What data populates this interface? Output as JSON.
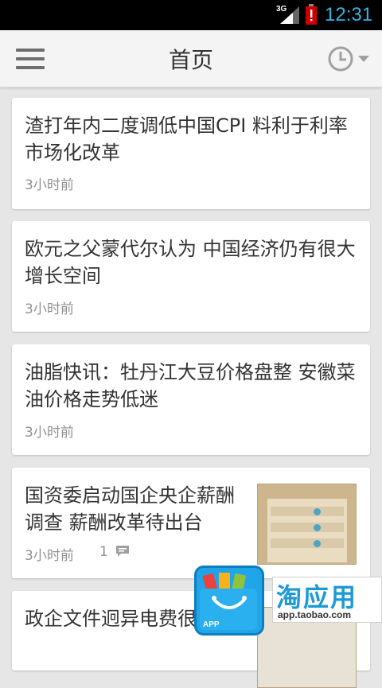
{
  "status_bar": {
    "network_type": "3G",
    "time": "12:31",
    "accent_color": "#33b5e5",
    "battery_color": "#cc0000"
  },
  "app_bar": {
    "title": "首页",
    "menu_icon": "hamburger-icon",
    "history_icon": "clock-icon"
  },
  "articles": [
    {
      "title": "渣打年内二度调低中国CPI 料利于利率市场化改革",
      "time": "3小时前",
      "comments": ""
    },
    {
      "title": "欧元之父蒙代尔认为 中国经济仍有很大增长空间",
      "time": "3小时前",
      "comments": ""
    },
    {
      "title": "油脂快讯：牡丹江大豆价格盘整 安徽菜油价格走势低迷",
      "time": "3小时前",
      "comments": ""
    },
    {
      "title": "国资委启动国企央企薪酬调查 薪酬改革待出台",
      "time": "3小时前",
      "comments": "1"
    },
    {
      "title": "政企文件迥异电费很",
      "time": "",
      "comments": ""
    }
  ],
  "ad_badge": {
    "name": "淘应用",
    "url": "app.taobao.com",
    "bag_label": "APP"
  }
}
